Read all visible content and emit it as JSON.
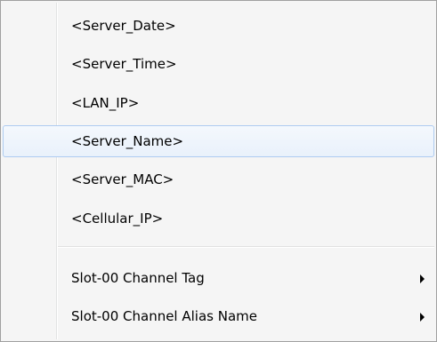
{
  "menu": {
    "items": [
      {
        "label": "<Server_Date>"
      },
      {
        "label": "<Server_Time>"
      },
      {
        "label": "<LAN_IP>"
      },
      {
        "label": "<Server_Name>"
      },
      {
        "label": "<Server_MAC>"
      },
      {
        "label": "<Cellular_IP>"
      },
      {
        "label": "Slot-00 Channel Tag"
      },
      {
        "label": "Slot-00 Channel Alias Name"
      }
    ]
  }
}
